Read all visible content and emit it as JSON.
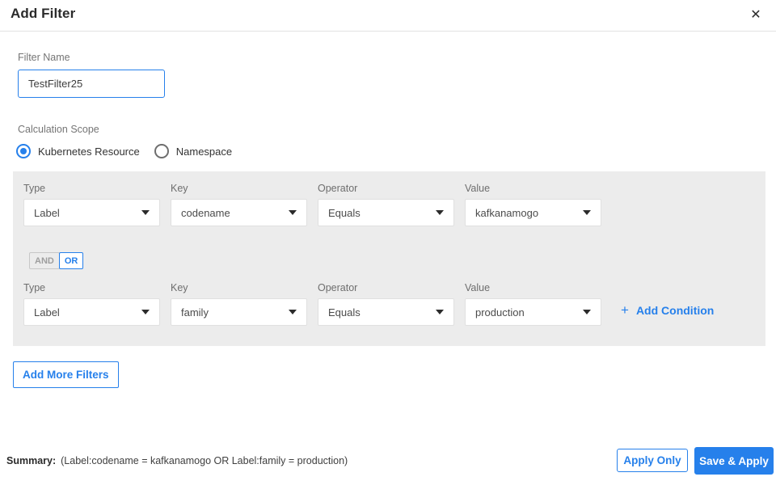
{
  "header": {
    "title": "Add Filter",
    "close_icon": "✕"
  },
  "filter_name": {
    "label": "Filter Name",
    "value": "TestFilter25"
  },
  "calculation_scope": {
    "label": "Calculation Scope",
    "options": [
      {
        "label": "Kubernetes Resource",
        "selected": true
      },
      {
        "label": "Namespace",
        "selected": false
      }
    ]
  },
  "conditions": {
    "column_labels": {
      "type": "Type",
      "key": "Key",
      "operator": "Operator",
      "value": "Value"
    },
    "rows": [
      {
        "type": "Label",
        "key": "codename",
        "operator": "Equals",
        "value": "kafkanamogo"
      },
      {
        "type": "Label",
        "key": "family",
        "operator": "Equals",
        "value": "production"
      }
    ],
    "logic_toggle": {
      "and": "AND",
      "or": "OR",
      "selected": "OR"
    },
    "add_condition": {
      "plus": "+",
      "label": "Add Condition"
    }
  },
  "add_more_filters_label": "Add More Filters",
  "footer": {
    "summary_label": "Summary:",
    "summary_text": "(Label:codename = kafkanamogo OR Label:family = production)",
    "buttons": {
      "apply_only": "Apply Only",
      "save_apply": "Save & Apply"
    }
  },
  "colors": {
    "accent": "#2680eb",
    "panel_bg": "#ececec",
    "title_text": "#2b2b2b",
    "body_text": "#4b4b4b",
    "label_gray": "#757575"
  }
}
